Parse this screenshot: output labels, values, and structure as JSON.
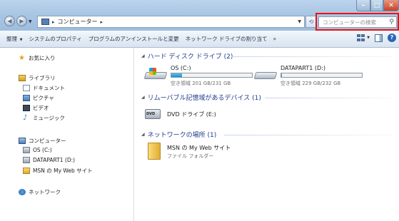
{
  "window": {
    "minimize_label": "–",
    "maximize_label": "□",
    "close_label": "✕"
  },
  "address_bar": {
    "path": [
      "コンピューター"
    ],
    "back_glyph": "◀",
    "forward_glyph": "▶"
  },
  "search": {
    "placeholder": "コンピューターの検索"
  },
  "toolbar": {
    "items": [
      "整理",
      "システムのプロパティ",
      "プログラムのアンインストールと変更",
      "ネットワーク ドライブの割り当て"
    ],
    "more": "»"
  },
  "nav": {
    "favorites": "お気に入り",
    "libraries": "ライブラリ",
    "documents": "ドキュメント",
    "pictures": "ピクチャ",
    "videos": "ビデオ",
    "music": "ミュージック",
    "computer": "コンピューター",
    "drive_c": "OS (C:)",
    "drive_d": "DATAPART1 (D:)",
    "msn": "MSN の My Web サイト",
    "network": "ネットワーク"
  },
  "content": {
    "hdd_group": "ハード ディスク ドライブ (2)",
    "removable_group": "リムーバブル記憶域があるデバイス (1)",
    "network_group": "ネットワークの場所 (1)",
    "drives": [
      {
        "name": "OS (C:)",
        "free_text": "空き領域 201 GB/231 GB",
        "used_fraction": 0.13
      },
      {
        "name": "DATAPART1 (D:)",
        "free_text": "空き領域 229 GB/232 GB",
        "used_fraction": 0.013
      }
    ],
    "dvd": {
      "name": "DVD ドライブ (E:)",
      "badge": "DVD"
    },
    "network_location": {
      "name": "MSN の My Web サイト",
      "type": "ファイル フォルダー"
    }
  },
  "colors": {
    "highlight": "#ee1111",
    "group_header": "#1e3a8a",
    "drive_fill": "#1b8ed0"
  }
}
